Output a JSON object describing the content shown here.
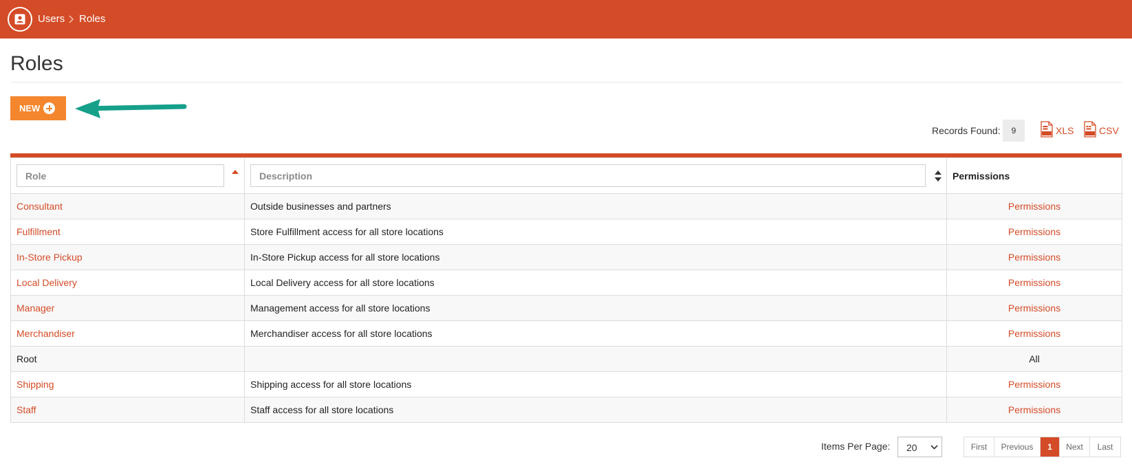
{
  "breadcrumb": {
    "items": [
      "Users",
      "Roles"
    ]
  },
  "page": {
    "title": "Roles"
  },
  "toolbar": {
    "new_label": "NEW"
  },
  "records": {
    "label": "Records Found:",
    "count": "9"
  },
  "export": {
    "xls_label": "XLS",
    "csv_label": "CSV"
  },
  "table": {
    "role_filter_placeholder": "Role",
    "description_filter_placeholder": "Description",
    "permissions_header": "Permissions",
    "rows": [
      {
        "role": "Consultant",
        "description": "Outside businesses and partners",
        "permissions": "Permissions"
      },
      {
        "role": "Fulfillment",
        "description": "Store Fulfillment access for all store locations",
        "permissions": "Permissions"
      },
      {
        "role": "In-Store Pickup",
        "description": "In-Store Pickup access for all store locations",
        "permissions": "Permissions"
      },
      {
        "role": "Local Delivery",
        "description": "Local Delivery access for all store locations",
        "permissions": "Permissions"
      },
      {
        "role": "Manager",
        "description": "Management access for all store locations",
        "permissions": "Permissions"
      },
      {
        "role": "Merchandiser",
        "description": "Merchandiser access for all store locations",
        "permissions": "Permissions"
      },
      {
        "role": "Root",
        "description": "",
        "permissions": "All"
      },
      {
        "role": "Shipping",
        "description": "Shipping access for all store locations",
        "permissions": "Permissions"
      },
      {
        "role": "Staff",
        "description": "Staff access for all store locations",
        "permissions": "Permissions"
      }
    ]
  },
  "pagination": {
    "items_per_page_label": "Items Per Page:",
    "items_per_page": "20",
    "first": "First",
    "previous": "Previous",
    "current_page": "1",
    "next": "Next",
    "last": "Last"
  },
  "colors": {
    "brand": "#d44b27",
    "button": "#f4862d",
    "arrow": "#15a08a"
  },
  "icons": {
    "logo": "user-card-icon",
    "separator": "chevron-right-icon",
    "new": "plus-circle-icon",
    "arrow": "arrow-left-icon",
    "xls": "xls-file-icon",
    "csv": "csv-file-icon"
  }
}
